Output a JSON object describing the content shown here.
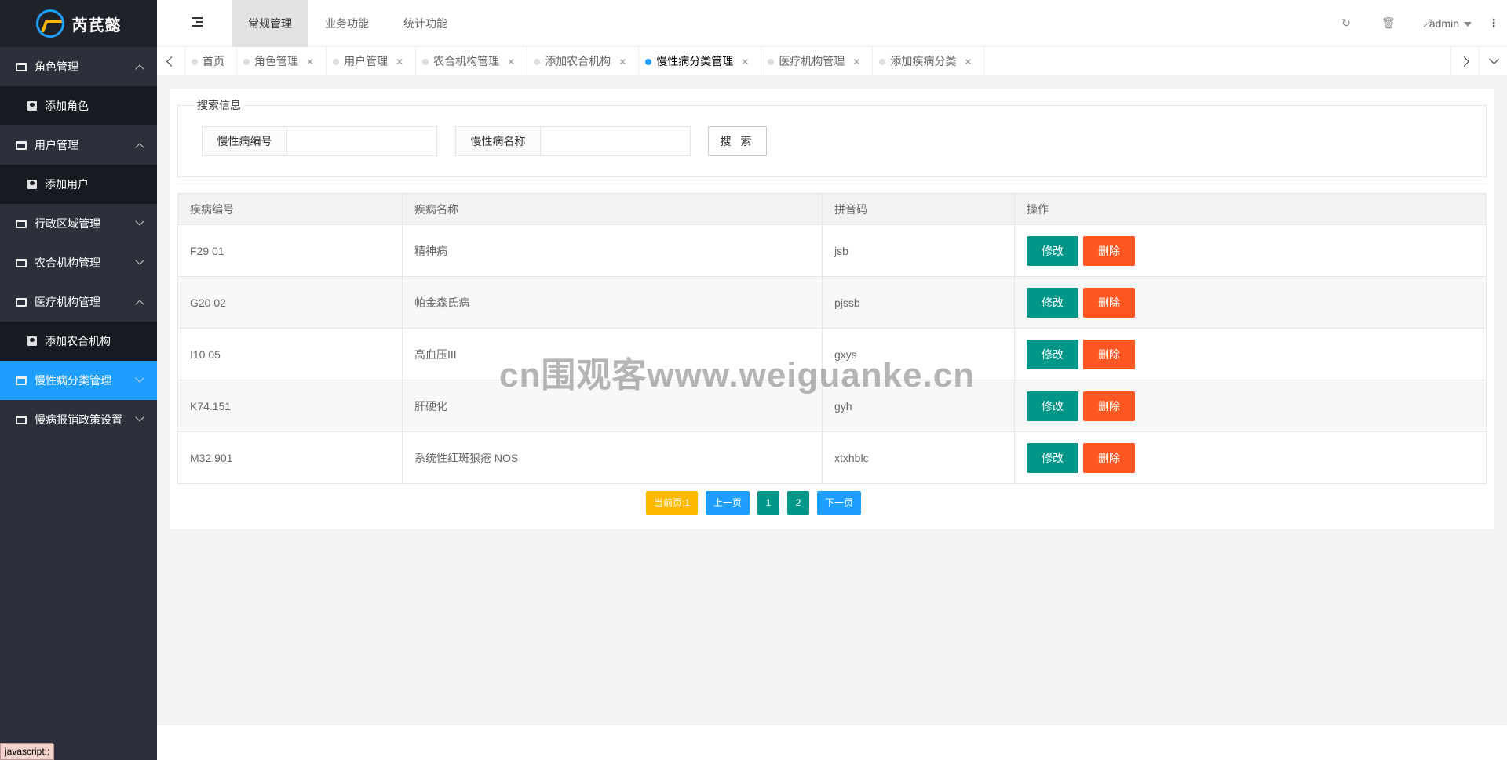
{
  "app": {
    "title": "芮芪懿"
  },
  "header": {
    "tabs": [
      "常规管理",
      "业务功能",
      "统计功能"
    ],
    "user": "admin"
  },
  "sidebar": {
    "items": [
      {
        "label": "角色管理",
        "state": "open",
        "children": [
          "添加角色"
        ]
      },
      {
        "label": "用户管理",
        "state": "open",
        "children": [
          "添加用户"
        ]
      },
      {
        "label": "行政区域管理",
        "state": "closed",
        "children": []
      },
      {
        "label": "农合机构管理",
        "state": "closed",
        "children": []
      },
      {
        "label": "医疗机构管理",
        "state": "open",
        "children": [
          "添加农合机构"
        ]
      },
      {
        "label": "慢性病分类管理",
        "state": "active",
        "children": []
      },
      {
        "label": "慢病报销政策设置",
        "state": "closed",
        "children": []
      }
    ]
  },
  "page_tabs": [
    {
      "label": "首页",
      "closable": false,
      "active": false
    },
    {
      "label": "角色管理",
      "closable": true,
      "active": false
    },
    {
      "label": "用户管理",
      "closable": true,
      "active": false
    },
    {
      "label": "农合机构管理",
      "closable": true,
      "active": false
    },
    {
      "label": "添加农合机构",
      "closable": true,
      "active": false
    },
    {
      "label": "慢性病分类管理",
      "closable": true,
      "active": true
    },
    {
      "label": "医疗机构管理",
      "closable": true,
      "active": false
    },
    {
      "label": "添加疾病分类",
      "closable": true,
      "active": false
    }
  ],
  "search": {
    "legend": "搜索信息",
    "code_label": "慢性病编号",
    "code_value": "",
    "name_label": "慢性病名称",
    "name_value": "",
    "button": "搜 索"
  },
  "table": {
    "headers": [
      "疾病编号",
      "疾病名称",
      "拼音码",
      "操作"
    ],
    "rows": [
      {
        "code": "F29 01",
        "name": "精神病",
        "pinyin": "jsb"
      },
      {
        "code": "G20 02",
        "name": "帕金森氏病",
        "pinyin": "pjssb"
      },
      {
        "code": "I10 05",
        "name": "高血压III",
        "pinyin": "gxys"
      },
      {
        "code": "K74.151",
        "name": "肝硬化",
        "pinyin": "gyh"
      },
      {
        "code": "M32.901",
        "name": "系统性红斑狼疮 NOS",
        "pinyin": "xtxhblc"
      }
    ],
    "edit_label": "修改",
    "delete_label": "删除"
  },
  "pager": {
    "current": "当前页:1",
    "prev": "上一页",
    "pages": [
      "1",
      "2"
    ],
    "next": "下一页"
  },
  "status_bar": "javascript:;",
  "watermark": "cn围观客www.weiguanke.cn",
  "colors": {
    "sidebar": "#2b303b",
    "accent": "#1e9fff",
    "edit": "#009688",
    "delete": "#ff5722",
    "current_page": "#ffb800"
  }
}
